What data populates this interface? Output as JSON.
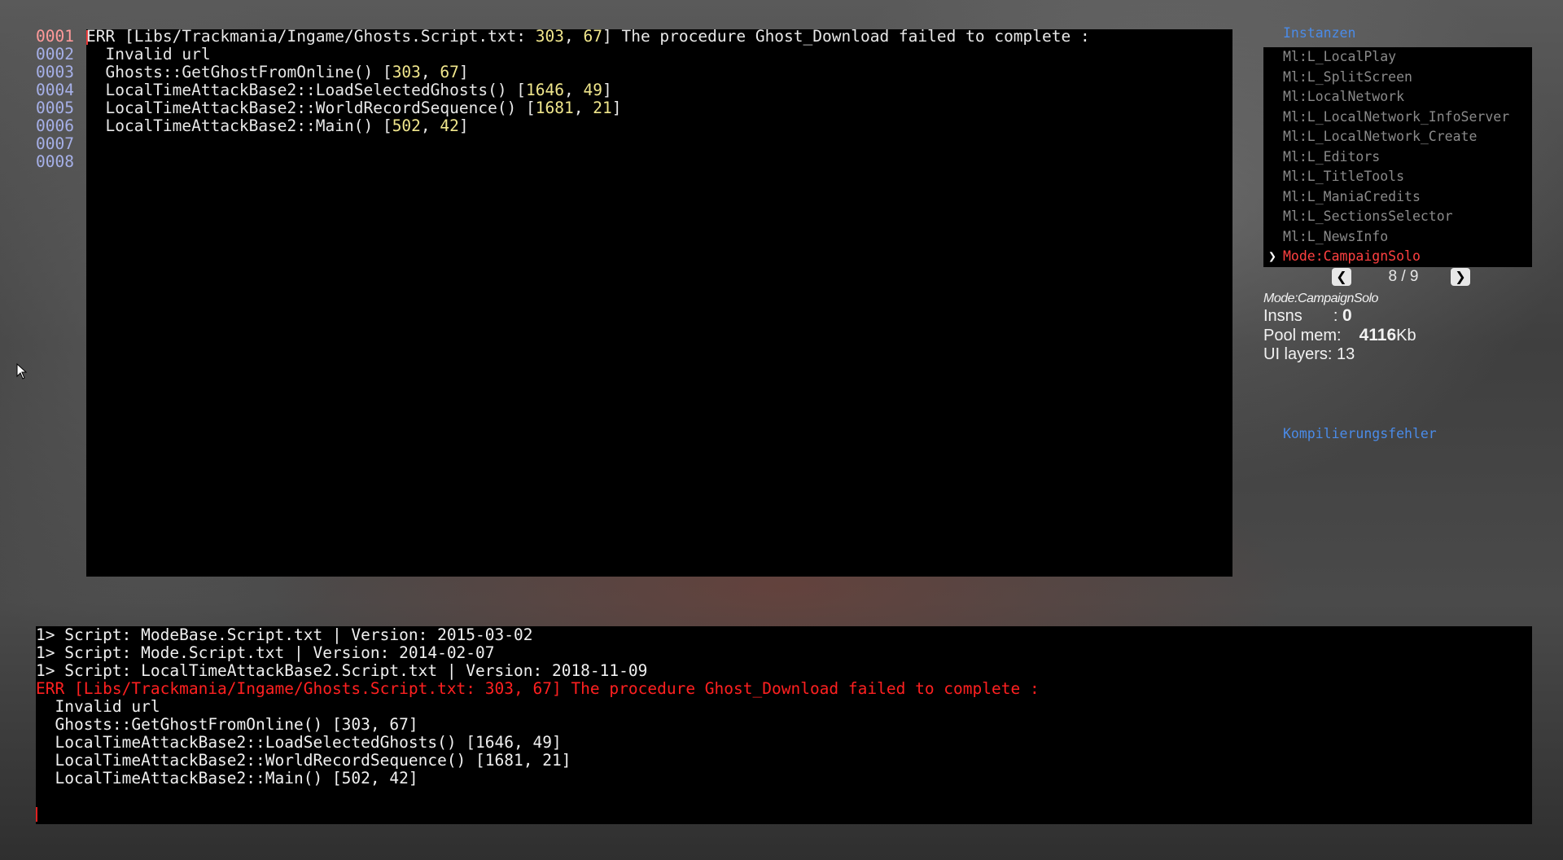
{
  "editor": {
    "line_numbers": [
      "0001",
      "0002",
      "0003",
      "0004",
      "0005",
      "0006",
      "0007",
      "0008"
    ],
    "lines": [
      {
        "parts": [
          {
            "t": "ERR [Libs/Trackmania/Ingame/Ghosts.Script.txt: "
          },
          {
            "t": "303",
            "n": true
          },
          {
            "t": ", "
          },
          {
            "t": "67",
            "n": true
          },
          {
            "t": "] The procedure Ghost_Download failed to complete :"
          }
        ]
      },
      {
        "parts": [
          {
            "t": "  Invalid url"
          }
        ]
      },
      {
        "parts": [
          {
            "t": "  Ghosts::GetGhostFromOnline() ["
          },
          {
            "t": "303",
            "n": true
          },
          {
            "t": ", "
          },
          {
            "t": "67",
            "n": true
          },
          {
            "t": "]"
          }
        ]
      },
      {
        "parts": [
          {
            "t": "  LocalTimeAttackBase2::LoadSelectedGhosts() ["
          },
          {
            "t": "1646",
            "n": true
          },
          {
            "t": ", "
          },
          {
            "t": "49",
            "n": true
          },
          {
            "t": "]"
          }
        ]
      },
      {
        "parts": [
          {
            "t": "  LocalTimeAttackBase2::WorldRecordSequence() ["
          },
          {
            "t": "1681",
            "n": true
          },
          {
            "t": ", "
          },
          {
            "t": "21",
            "n": true
          },
          {
            "t": "]"
          }
        ]
      },
      {
        "parts": [
          {
            "t": "  LocalTimeAttackBase2::Main() ["
          },
          {
            "t": "502",
            "n": true
          },
          {
            "t": ", "
          },
          {
            "t": "42",
            "n": true
          },
          {
            "t": "]"
          }
        ]
      },
      {
        "parts": [
          {
            "t": ""
          }
        ]
      },
      {
        "parts": [
          {
            "t": ""
          }
        ]
      }
    ]
  },
  "instances": {
    "title": "Instanzen",
    "items": [
      {
        "label": "Ml:L_LocalPlay",
        "active": false
      },
      {
        "label": "Ml:L_SplitScreen",
        "active": false
      },
      {
        "label": "Ml:LocalNetwork",
        "active": false
      },
      {
        "label": "Ml:L_LocalNetwork_InfoServer",
        "active": false
      },
      {
        "label": "Ml:L_LocalNetwork_Create",
        "active": false
      },
      {
        "label": "Ml:L_Editors",
        "active": false
      },
      {
        "label": "Ml:L_TitleTools",
        "active": false
      },
      {
        "label": "Ml:L_ManiaCredits",
        "active": false
      },
      {
        "label": "Ml:L_SectionsSelector",
        "active": false
      },
      {
        "label": "Ml:L_NewsInfo",
        "active": false
      },
      {
        "label": "Mode:CampaignSolo",
        "active": true
      }
    ],
    "selected_marker": "❯",
    "pager": {
      "prev": "❮",
      "text": "8 / 9",
      "next": "❯"
    }
  },
  "info": {
    "mode": "Mode:CampaignSolo",
    "insns_label": "Insns",
    "insns_sep": ":",
    "insns_value": "0",
    "pool_label": "Pool mem:",
    "pool_value": "4116",
    "pool_unit": "Kb",
    "layers": "UI layers: 13"
  },
  "compile_link": "Kompilierungsfehler",
  "console": {
    "lines": [
      {
        "text": "1> Script: ModeBase.Script.txt | Version: 2015-03-02",
        "err": false
      },
      {
        "text": "1> Script: Mode.Script.txt | Version: 2014-02-07",
        "err": false
      },
      {
        "text": "1> Script: LocalTimeAttackBase2.Script.txt | Version: 2018-11-09",
        "err": false
      },
      {
        "text": "ERR [Libs/Trackmania/Ingame/Ghosts.Script.txt: 303, 67] The procedure Ghost_Download failed to complete :",
        "err": true
      },
      {
        "text": "  Invalid url",
        "err": false
      },
      {
        "text": "  Ghosts::GetGhostFromOnline() [303, 67]",
        "err": false
      },
      {
        "text": "  LocalTimeAttackBase2::LoadSelectedGhosts() [1646, 49]",
        "err": false
      },
      {
        "text": "  LocalTimeAttackBase2::WorldRecordSequence() [1681, 21]",
        "err": false
      },
      {
        "text": "  LocalTimeAttackBase2::Main() [502, 42]",
        "err": false
      }
    ]
  },
  "colors": {
    "accent_link": "#4a8be8",
    "error": "#ff2020",
    "number_highlight": "#f0e68c",
    "line_number": "#a6b0e8"
  }
}
